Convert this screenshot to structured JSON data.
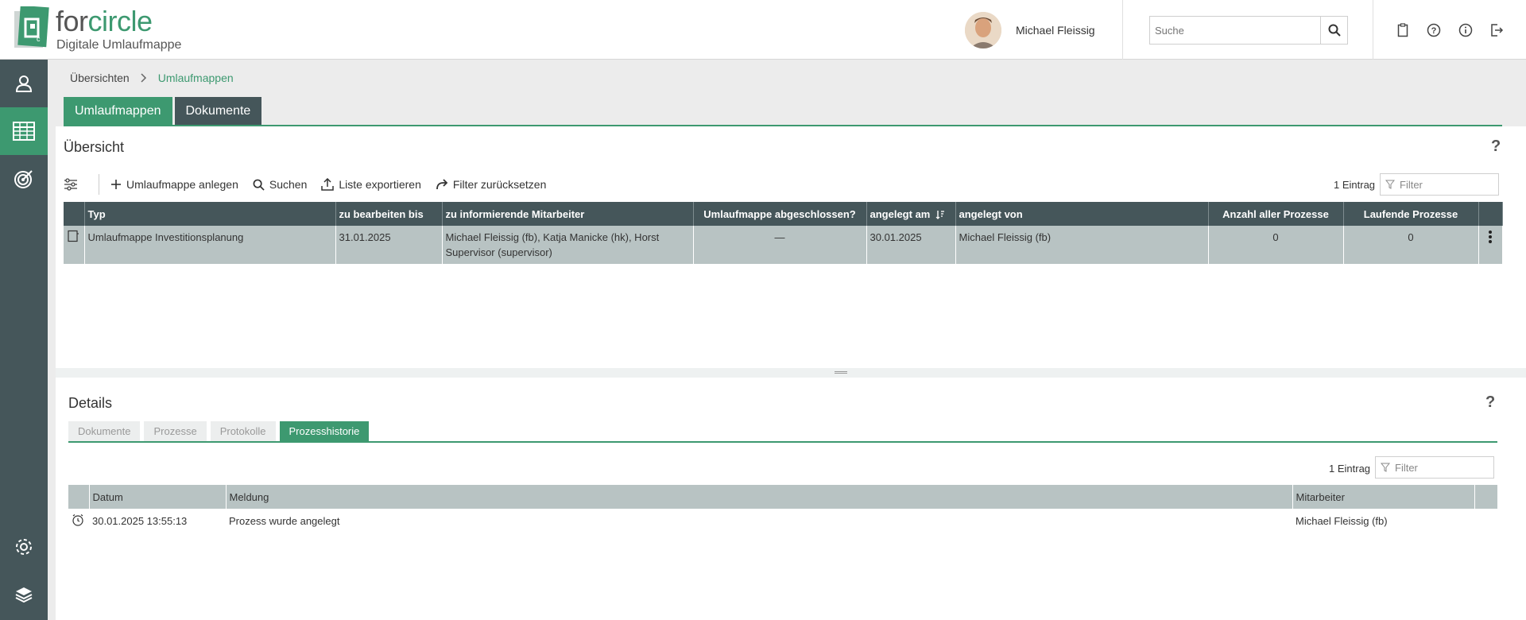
{
  "header": {
    "brand_prefix": "for",
    "brand_accent": "circle",
    "brand_subtitle": "Digitale Umlaufmappe",
    "user_name": "Michael Fleissig",
    "search_placeholder": "Suche"
  },
  "breadcrumb": {
    "root": "Übersichten",
    "current": "Umlaufmappen"
  },
  "top_tabs": [
    "Umlaufmappen",
    "Dokumente"
  ],
  "overview": {
    "title": "Übersicht",
    "help": "?",
    "toolbar": {
      "create": "Umlaufmappe anlegen",
      "search": "Suchen",
      "export": "Liste exportieren",
      "reset": "Filter zurücksetzen"
    },
    "count": "1 Eintrag",
    "filter_placeholder": "Filter",
    "columns": [
      "Typ",
      "zu bearbeiten bis",
      "zu informierende Mitarbeiter",
      "Umlaufmappe abgeschlossen?",
      "angelegt am",
      "angelegt von",
      "Anzahl aller Prozesse",
      "Laufende Prozesse"
    ],
    "row": {
      "typ": "Umlaufmappe Investitionsplanung",
      "bis": "31.01.2025",
      "mitarbeiter": "Michael Fleissig (fb), Katja Manicke (hk), Horst Supervisor (supervisor)",
      "abgeschlossen": "—",
      "angelegt_am": "30.01.2025",
      "angelegt_von": "Michael Fleissig (fb)",
      "anzahl": "0",
      "laufend": "0"
    }
  },
  "details": {
    "title": "Details",
    "help": "?",
    "tabs": [
      "Dokumente",
      "Prozesse",
      "Protokolle",
      "Prozesshistorie"
    ],
    "count": "1 Eintrag",
    "filter_placeholder": "Filter",
    "columns": [
      "Datum",
      "Meldung",
      "Mitarbeiter"
    ],
    "row": {
      "datum": "30.01.2025 13:55:13",
      "meldung": "Prozess wurde angelegt",
      "mitarbeiter": "Michael Fleissig (fb)"
    }
  },
  "colors": {
    "accent": "#3d9970",
    "dark": "#45565a",
    "row_bg": "#b8c3c3"
  }
}
